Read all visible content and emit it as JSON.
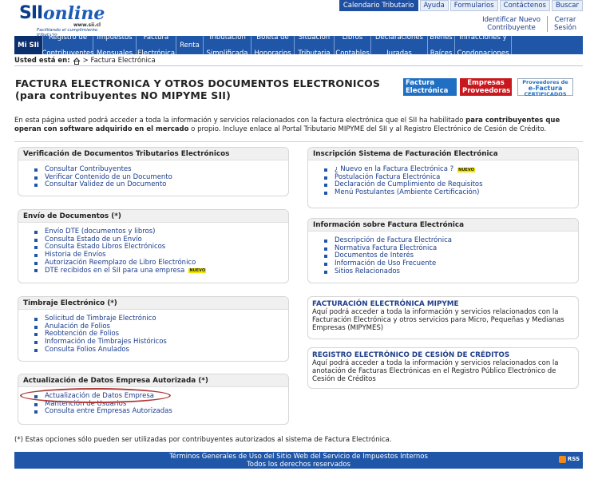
{
  "logo": {
    "sii": "SII",
    "online": "online",
    "url": "www.sii.cl",
    "tagline": "Facilitando el cumplimiento tributario"
  },
  "toplinks": [
    "Calendario Tributario",
    "Ayuda",
    "Formularios",
    "Contáctenos",
    "Buscar"
  ],
  "usertools": [
    [
      "Identificar Nuevo",
      "Contribuyente"
    ],
    [
      "Cerrar",
      "Sesión"
    ]
  ],
  "mainnav": [
    [
      "Mi SII"
    ],
    [
      "Registro de",
      "Contribuyentes"
    ],
    [
      "Impuestos",
      "Mensuales"
    ],
    [
      "Factura",
      "Electrónica"
    ],
    [
      "Renta"
    ],
    [
      "Tributación",
      "Simplificada"
    ],
    [
      "Boleta de",
      "Honorarios"
    ],
    [
      "Situación",
      "Tributaria"
    ],
    [
      "Libros",
      "Contables"
    ],
    [
      "Declaraciones",
      "Juradas"
    ],
    [
      "Bienes",
      "Raíces"
    ],
    [
      "Infracciones y",
      "Condonaciones"
    ]
  ],
  "breadcrumb": {
    "label": "Usted está en:",
    "path": "> Factura Electrónica"
  },
  "title": {
    "line1": "FACTURA ELECTRONICA Y OTROS DOCUMENTOS ELECTRONICOS",
    "line2": "(para contribuyentes NO MIPYME SII)"
  },
  "badges": {
    "factura": [
      "Factura",
      "Electrónica"
    ],
    "empresas": [
      "Empresas",
      "Proveedoras"
    ],
    "proveedores": [
      "Proveedores de",
      "e-Factura",
      "CERTIFICADOS"
    ]
  },
  "intro": {
    "part1": "En esta página usted podrá acceder a toda la información y servicios relacionados con la factura electrónica que el SII ha habilitado ",
    "bold": "para contribuyentes que operan con software adquirido en el mercado",
    "part2": " o propio. Incluye enlace al Portal Tributario MIPYME del SII y al Registro Electrónico de Cesión de Crédito."
  },
  "nuevo": "NUEVO",
  "boxes": {
    "verificacion": {
      "title": "Verificación de Documentos Tributarios Electrónicos",
      "items": [
        "Consultar Contribuyentes",
        "Verificar Contenido de un Documento",
        "Consultar Validez de un Documento"
      ]
    },
    "envio": {
      "title": "Envío de Documentos (*)",
      "items": [
        "Envío DTE (documentos y libros)",
        "Consulta Estado de un Envío",
        "Consulta Estado Libros Electrónicos",
        "Historia de Envíos",
        "Autorización Reemplazo de Libro Electrónico",
        "DTE recibidos en el SII para una empresa"
      ]
    },
    "timbraje": {
      "title": "Timbraje Electrónico (*)",
      "items": [
        "Solicitud de Timbraje Electrónico",
        "Anulación de Folios",
        "Reobtención de Folios",
        "Información de Timbrajes Históricos",
        "Consulta Folios Anulados"
      ]
    },
    "actualizacion": {
      "title": "Actualización de Datos Empresa Autorizada (*)",
      "items": [
        "Actualización de Datos Empresa",
        "Mantención de Usuarios",
        "Consulta entre Empresas Autorizadas"
      ]
    },
    "inscripcion": {
      "title": "Inscripción Sistema de Facturación Electrónica",
      "items": [
        "¿ Nuevo en la Factura Electrónica ?",
        "Postulación Factura Electrónica",
        "Declaración de Cumplimiento de Requisitos",
        "Menú Postulantes (Ambiente Certificación)"
      ]
    },
    "informacion": {
      "title": "Información sobre Factura Electrónica",
      "items": [
        "Descripción de Factura Electrónica",
        "Normativa Factura Electrónica",
        "Documentos de Interés",
        "Información de Uso Frecuente",
        "Sitios Relacionados"
      ]
    },
    "mipyme": {
      "title": "FACTURACIÓN ELECTRÓNICA MIPYME",
      "desc": "Aquí podrá acceder a toda la información y servicios relacionados con la Facturación Electrónica y otros servicios para Micro, Pequeñas y Medianas Empresas (MIPYMES)"
    },
    "cesion": {
      "title": "REGISTRO ELECTRÓNICO DE CESIÓN DE CRÉDITOS",
      "desc": "Aquí podrá acceder a toda la información y servicios relacionados con la anotación de Facturas Electrónicas en el Registro Público Electrónico de Cesión de Créditos"
    }
  },
  "footnote": "(*) Estas opciones sólo pueden ser utilizadas por contribuyentes autorizados al sistema de Factura Electrónica.",
  "footer": {
    "line1": "Términos Generales de Uso del Sitio Web del Servicio de Impuestos Internos",
    "line2": "Todos los derechos reservados",
    "rss": "RSS"
  }
}
